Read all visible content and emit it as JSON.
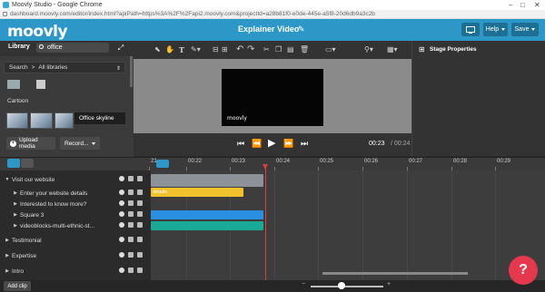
{
  "browser": {
    "window_title": "Moovly Studio - Google Chrome",
    "url": "dashboard.moovly.com/editor/index.html?apiPath=https%3A%2F%2Fapi2.moovly.com&projectId=a28b81f0-e0de-445e-a5f8-20d6db9a3c2b"
  },
  "header": {
    "logo": "moovly",
    "project_title": "Explainer Video",
    "help_label": "Help",
    "save_label": "Save",
    "accent": "#2d97c7"
  },
  "library": {
    "title": "Library",
    "search_value": "office",
    "crumb_search": "Search",
    "crumb_sep": ">",
    "crumb_all": "All libraries",
    "section": "Cartoon",
    "tooltip": "Office skyline",
    "upload_label": "Upload media",
    "record_label": "Record..."
  },
  "stage": {
    "canvas_logo": "moovly"
  },
  "player": {
    "time_current": "00:23",
    "time_total": "/ 00:24"
  },
  "properties": {
    "title": "Stage Properties"
  },
  "timeline": {
    "ticks": [
      "21",
      "00:22",
      "00:23",
      "00:24",
      "00:25",
      "00:26",
      "00:27",
      "00:28",
      "00:29"
    ],
    "rows": [
      {
        "label": "Visit our website",
        "arrow": "▼"
      },
      {
        "label": "Enter your website details",
        "arrow": "▶"
      },
      {
        "label": "Interested to know more?",
        "arrow": "▶"
      },
      {
        "label": "Square 3",
        "arrow": "▶"
      },
      {
        "label": "videoblocks-multi-ethnic-st...",
        "arrow": "▶"
      },
      {
        "label": "Testimonial",
        "arrow": "▶"
      },
      {
        "label": "Expertise",
        "arrow": "▶"
      },
      {
        "label": "Intro",
        "arrow": "▶"
      }
    ],
    "bar_label": "details",
    "colors": {
      "group_bar": "#8c9297",
      "yellow": "#f2c12e",
      "blue": "#2a8fe0",
      "teal": "#1aa897",
      "playhead": "#e03e3e"
    },
    "add_clip_label": "Add clip"
  },
  "help_bubble": "?"
}
